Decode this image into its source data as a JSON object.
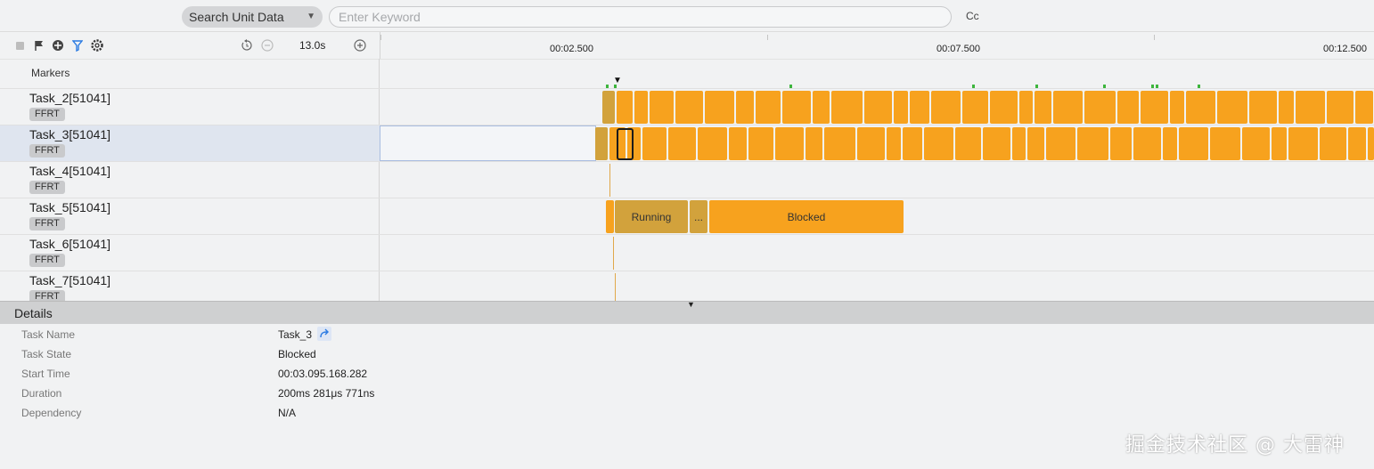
{
  "search": {
    "scope_label": "Search Unit Data",
    "keyword_placeholder": "Enter Keyword",
    "keyword_value": "",
    "case_toggle": "Cc"
  },
  "toolbar": {
    "icons": [
      "stop-icon",
      "flag-icon",
      "crosshair-icon",
      "filter-icon",
      "settings-icon",
      "reset-zoom-icon",
      "zoom-out-icon",
      "zoom-in-icon"
    ],
    "zoom_level": "13.0s"
  },
  "timeline": {
    "ticks": [
      "00:02.500",
      "00:07.500",
      "00:12.500"
    ]
  },
  "markers_label": "Markers",
  "tasks": [
    {
      "name": "Task_2[51041]",
      "badge": "FFRT"
    },
    {
      "name": "Task_3[51041]",
      "badge": "FFRT",
      "selected": true
    },
    {
      "name": "Task_4[51041]",
      "badge": "FFRT"
    },
    {
      "name": "Task_5[51041]",
      "badge": "FFRT"
    },
    {
      "name": "Task_6[51041]",
      "badge": "FFRT"
    },
    {
      "name": "Task_7[51041]",
      "badge": "FFRT"
    }
  ],
  "task5_states": {
    "running": "Running",
    "ellipsis": "...",
    "blocked": "Blocked"
  },
  "details": {
    "title": "Details",
    "fields": [
      {
        "key": "Task Name",
        "value": "Task_3"
      },
      {
        "key": "Task State",
        "value": "Blocked"
      },
      {
        "key": "Start Time",
        "value": "00:03.095.168.282"
      },
      {
        "key": "Duration",
        "value": "200ms 281μs 771ns"
      },
      {
        "key": "Dependency",
        "value": "N/A"
      }
    ]
  },
  "colors": {
    "running_slice": "#f7a21e",
    "dim_slice": "#d2a23c",
    "marker_tick": "#3db53d",
    "selection_fill": "#dfe5ef"
  },
  "watermark": "掘金技术社区 @ 大雷神"
}
